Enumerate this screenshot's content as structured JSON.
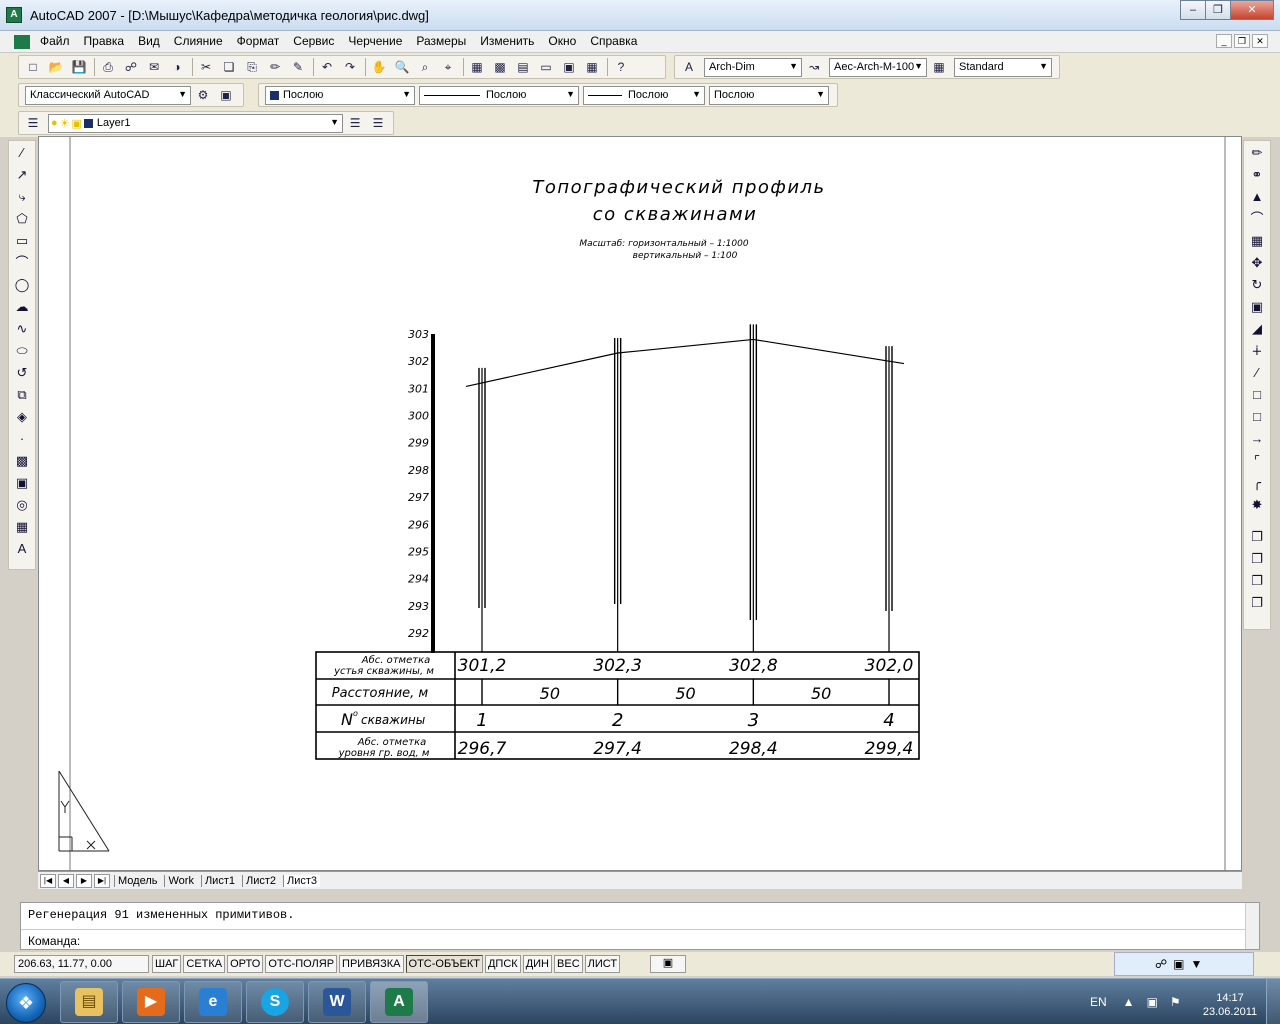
{
  "window": {
    "title": "AutoCAD 2007 - [D:\\Мышус\\Кафедра\\методичка геология\\рис.dwg]",
    "minimize_label": "0",
    "maximize_label": "1",
    "close_label": "r"
  },
  "menu": {
    "items": [
      "Файл",
      "Правка",
      "Вид",
      "Слияние",
      "Формат",
      "Сервис",
      "Черчение",
      "Размеры",
      "Изменить",
      "Окно",
      "Справка"
    ]
  },
  "toolbars": {
    "dimstyle": "Arch-Dim",
    "mleaderstyle": "Aec-Arch-M-100",
    "textstyle": "Standard",
    "workspace": "Классический AutoCAD",
    "color": "Послою",
    "linetype": "Послою",
    "lineweight": "Послою",
    "plotstyle": "Послою",
    "layer": "Layer1"
  },
  "drawing": {
    "title_line1": "Топографический профиль",
    "title_line2": "со скважинами",
    "scale_line1": "Масштаб: горизонтальный – 1:1000",
    "scale_line2": "вертикальный – 1:100",
    "axis_ticks": [
      "303",
      "302",
      "301",
      "300",
      "299",
      "298",
      "297",
      "296",
      "295",
      "294",
      "293",
      "292"
    ],
    "table": {
      "row1_label_a": "Абс. отметка",
      "row1_label_b": "устья скважины, м",
      "row1_values": [
        "301,2",
        "302,3",
        "302,8",
        "302,0"
      ],
      "row2_label": "Расстояние, м",
      "row2_values": [
        "50",
        "50",
        "50"
      ],
      "row3_label_prefix": "N",
      "row3_label_sup": "o",
      "row3_label_suffix": "скважины",
      "row3_values": [
        "1",
        "2",
        "3",
        "4"
      ],
      "row4_label_a": "Абс. отметка",
      "row4_label_b": "уровня гр. вод, м",
      "row4_values": [
        "296,7",
        "297,4",
        "298,4",
        "299,4"
      ]
    }
  },
  "chart_data": {
    "type": "line",
    "title": "Топографический профиль со скважинами",
    "x": [
      0,
      50,
      100,
      150
    ],
    "categories": [
      "1",
      "2",
      "3",
      "4"
    ],
    "series": [
      {
        "values": [
          301.2,
          302.3,
          302.8,
          302.0
        ]
      },
      {
        "values": [
          296.7,
          297.4,
          298.4,
          299.4
        ]
      }
    ],
    "ylim": [
      292,
      303
    ],
    "xlabel": "Расстояние, м",
    "ylabel": ""
  },
  "tabs": [
    "Модель",
    "Work",
    "Лист1",
    "Лист2",
    "Лист3"
  ],
  "active_tab": "Лист3",
  "command": {
    "history": "Регенерация 91 измененных примитивов.",
    "prompt": "Команда:"
  },
  "status": {
    "coords": "206.63, 11.77, 0.00",
    "buttons": [
      "ШАГ",
      "СЕТКА",
      "ОРТО",
      "ОТС-ПОЛЯР",
      "ПРИВЯЗКА",
      "ОТС-ОБЪЕКТ",
      "ДПСК",
      "ДИН",
      "ВЕС",
      "ЛИСТ"
    ],
    "on_buttons": [
      "ОТС-ОБЪЕКТ"
    ]
  },
  "taskbar": {
    "lang": "EN",
    "time": "14:17",
    "date": "23.06.2011"
  }
}
